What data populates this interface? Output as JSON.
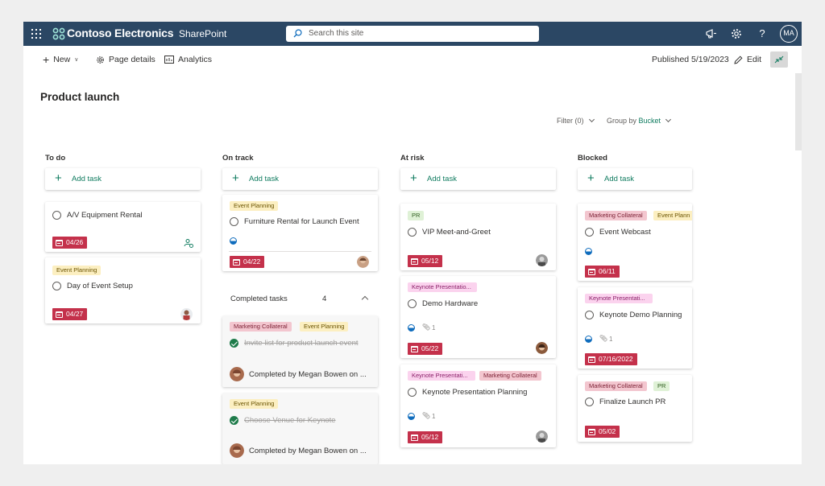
{
  "suite": {
    "brand": "Contoso Electronics",
    "app": "SharePoint",
    "search_placeholder": "Search this site",
    "user_initials": "MA",
    "icons": [
      "waffle-icon",
      "megaphone-icon",
      "gear-icon",
      "help-icon"
    ]
  },
  "command_bar": {
    "new_label": "New",
    "page_details_label": "Page details",
    "analytics_label": "Analytics",
    "published": "Published 5/19/2023",
    "edit_label": "Edit"
  },
  "page": {
    "title": "Product launch",
    "filter_label": "Filter (0)",
    "group_by_prefix": "Group by",
    "group_by_value": "Bucket"
  },
  "colors": {
    "suite_bar": "#2b4764",
    "accent_green": "#0f7b5f",
    "overdue_red": "#c4314b"
  },
  "add_task_label": "Add task",
  "columns": [
    {
      "title": "To do",
      "cards": [
        {
          "title": "A/V Equipment Rental",
          "due": "04/26",
          "tags": []
        },
        {
          "title": "Day of Event Setup",
          "due": "04/27",
          "tags": [
            "Event Planning"
          ]
        }
      ]
    },
    {
      "title": "On track",
      "cards": [
        {
          "title": "Furniture Rental for Launch Event",
          "due": "04/22",
          "tags": [
            "Event Planning"
          ]
        }
      ],
      "completed": {
        "label": "Completed tasks",
        "count": "4",
        "cards": [
          {
            "title": "Invite list for product launch event",
            "tags": [
              "Marketing Collateral",
              "Event Planning"
            ],
            "completed_by": "Completed by Megan Bowen on ..."
          },
          {
            "title": "Choose Venue for Keynote",
            "tags": [
              "Event Planning"
            ],
            "completed_by": "Completed by Megan Bowen on ..."
          }
        ]
      }
    },
    {
      "title": "At risk",
      "cards": [
        {
          "title": "VIP Meet-and-Greet",
          "due": "05/12",
          "tags": [
            "PR"
          ]
        },
        {
          "title": "Demo Hardware",
          "due": "05/22",
          "tags": [
            "Keynote Presentatio..."
          ],
          "attachments": "1"
        },
        {
          "title": "Keynote Presentation Planning",
          "due": "05/12",
          "tags": [
            "Keynote Presentati...",
            "Marketing Collateral"
          ],
          "attachments": "1"
        }
      ]
    },
    {
      "title": "Blocked",
      "cards": [
        {
          "title": "Event Webcast",
          "due": "06/11",
          "tags": [
            "Marketing Collateral",
            "Event Plann"
          ]
        },
        {
          "title": "Keynote Demo Planning",
          "due": "07/16/2022",
          "tags": [
            "Keynote Presentati..."
          ],
          "attachments": "1"
        },
        {
          "title": "Finalize Launch PR",
          "due": "05/02",
          "tags": [
            "Marketing Collateral",
            "PR"
          ]
        }
      ]
    }
  ]
}
